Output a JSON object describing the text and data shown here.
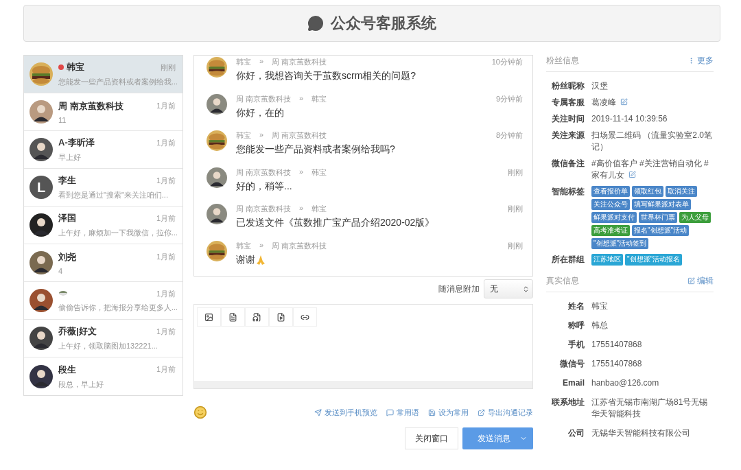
{
  "header": {
    "title": "公众号客服系统"
  },
  "conversations": [
    {
      "kind": "text-name",
      "name": "韩宝",
      "unread": true,
      "selected": true,
      "time": "刚刚",
      "preview": "您能发一些产品资料或者案例给我..."
    },
    {
      "kind": "text-name",
      "name": "周 南京茧数科技",
      "unread": false,
      "selected": false,
      "time": "1月前",
      "preview": "11"
    },
    {
      "kind": "text-name",
      "name": "A-李昕泽",
      "unread": false,
      "selected": false,
      "time": "1月前",
      "preview": "早上好"
    },
    {
      "kind": "text-name",
      "name": "李生",
      "avatar_letter": "L",
      "unread": false,
      "selected": false,
      "time": "1月前",
      "preview": "看到您是通过\"搜索\"来关注咱们..."
    },
    {
      "kind": "text-name",
      "name": "泽国",
      "unread": false,
      "selected": false,
      "time": "1月前",
      "preview": "上午好，麻烦加一下我微信，拉你..."
    },
    {
      "kind": "text-name",
      "name": "刘尧",
      "unread": false,
      "selected": false,
      "time": "1月前",
      "preview": "4"
    },
    {
      "kind": "icon-name",
      "unread": false,
      "selected": false,
      "time": "1月前",
      "preview": "偷偷告诉你，把海报分享给更多人..."
    },
    {
      "kind": "text-name",
      "name": "乔薇|好文",
      "unread": false,
      "selected": false,
      "time": "1月前",
      "preview": "上午好，领取脑图加132221..."
    },
    {
      "kind": "text-name",
      "name": "段生",
      "unread": false,
      "selected": false,
      "time": "1月前",
      "preview": "段总，早上好"
    }
  ],
  "messages": [
    {
      "kind": "customer",
      "from": "韩宝",
      "arrow": "»",
      "to": "周 南京茧数科技",
      "time": "10分钟前",
      "text": "你好，我想咨询关于茧数scrm相关的问题?"
    },
    {
      "kind": "agent",
      "from": "周 南京茧数科技",
      "arrow": "»",
      "to": "韩宝",
      "time": "9分钟前",
      "text": "你好，在的"
    },
    {
      "kind": "customer",
      "from": "韩宝",
      "arrow": "»",
      "to": "周 南京茧数科技",
      "time": "8分钟前",
      "text": "您能发一些产品资料或者案例给我吗?"
    },
    {
      "kind": "agent",
      "from": "周 南京茧数科技",
      "arrow": "»",
      "to": "韩宝",
      "time": "刚刚",
      "text": "好的，稍等..."
    },
    {
      "kind": "agent",
      "from": "周 南京茧数科技",
      "arrow": "»",
      "to": "韩宝",
      "time": "刚刚",
      "text": "已发送文件《茧数推广宝产品介绍2020-02版》"
    },
    {
      "kind": "customer",
      "from": "韩宝",
      "arrow": "»",
      "to": "周 南京茧数科技",
      "time": "刚刚",
      "text": "谢谢",
      "pray_icon": true
    }
  ],
  "attach": {
    "label": "随消息附加",
    "value": "无"
  },
  "actions": [
    "发送到手机预览",
    "常用语",
    "设为常用",
    "导出沟通记录"
  ],
  "buttons": {
    "close": "关闭窗口",
    "send": "发送消息"
  },
  "fan_info": {
    "title": "粉丝信息",
    "more": "更多",
    "fields": [
      {
        "kind": "text",
        "label": "粉丝昵称",
        "value": "汉堡"
      },
      {
        "kind": "text",
        "label": "专属客服",
        "value": "葛凌峰",
        "editable": true
      },
      {
        "kind": "text",
        "label": "关注时间",
        "value": "2019-11-14 10:39:56"
      },
      {
        "kind": "text",
        "label": "关注来源",
        "value": "扫场景二维码 （流量实验室2.0笔记）"
      },
      {
        "kind": "text",
        "label": "微信备注",
        "value": "#高价值客户 #关注营销自动化 #家有儿女",
        "editable": true
      },
      {
        "kind": "tags",
        "label": "智能标签",
        "tags": [
          {
            "text": "查看报价单",
            "color": "#4a86c8"
          },
          {
            "text": "领取红包",
            "color": "#4a86c8"
          },
          {
            "text": "取消关注",
            "color": "#4a86c8"
          },
          {
            "text": "关注公众号",
            "color": "#4a86c8"
          },
          {
            "text": "填写鲜果派对表单",
            "color": "#4a86c8"
          },
          {
            "text": "鲜果派对支付",
            "color": "#4a86c8"
          },
          {
            "text": "世界杯门票",
            "color": "#4a86c8"
          },
          {
            "text": "为人父母",
            "color": "#3c9e3c"
          },
          {
            "text": "高考准考证",
            "color": "#3c9e3c"
          },
          {
            "text": "报名\"创想派\"活动",
            "color": "#4a86c8"
          },
          {
            "text": "\"创想派\"活动签到",
            "color": "#4a86c8"
          }
        ]
      },
      {
        "kind": "tags",
        "label": "所在群组",
        "tags": [
          {
            "text": "江苏地区",
            "color": "#2aa6d5"
          },
          {
            "text": "\"创想派\"活动报名",
            "color": "#2aa6d5"
          }
        ]
      }
    ]
  },
  "real_info": {
    "title": "真实信息",
    "edit": "编辑",
    "fields": [
      {
        "label": "姓名",
        "value": "韩宝"
      },
      {
        "label": "称呼",
        "value": "韩总"
      },
      {
        "label": "手机",
        "value": "17551407868"
      },
      {
        "label": "微信号",
        "value": "17551407868"
      },
      {
        "label": "Email",
        "value": "hanbao@126.com"
      },
      {
        "label": "联系地址",
        "value": "江苏省无锡市南湖广场81号无锡华天智能科技"
      },
      {
        "label": "公司",
        "value": "无锡华天智能科技有限公司"
      }
    ]
  }
}
